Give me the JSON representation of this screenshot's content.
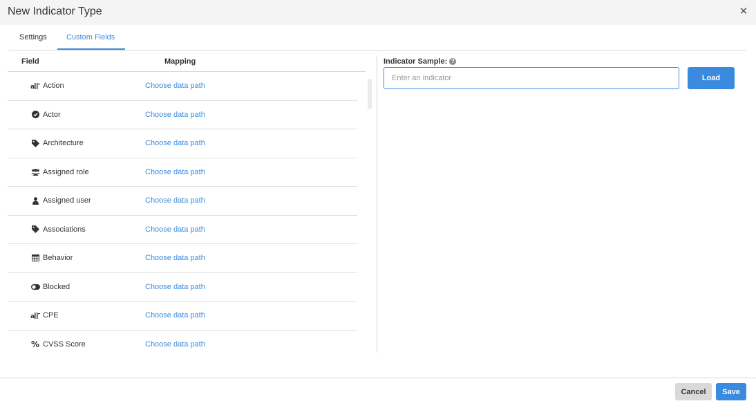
{
  "dialog": {
    "title": "New Indicator Type",
    "close_icon": "close-icon"
  },
  "tabs": [
    {
      "label": "Settings",
      "active": false
    },
    {
      "label": "Custom Fields",
      "active": true
    }
  ],
  "table": {
    "columns": [
      "Field",
      "Mapping"
    ],
    "rows": [
      {
        "icon": "short-text-icon",
        "label": "Action",
        "mapping": "Choose data path"
      },
      {
        "icon": "check-circle-icon",
        "label": "Actor",
        "mapping": "Choose data path"
      },
      {
        "icon": "tag-icon",
        "label": "Architecture",
        "mapping": "Choose data path"
      },
      {
        "icon": "users-icon",
        "label": "Assigned role",
        "mapping": "Choose data path"
      },
      {
        "icon": "user-icon",
        "label": "Assigned user",
        "mapping": "Choose data path"
      },
      {
        "icon": "tag-icon",
        "label": "Associations",
        "mapping": "Choose data path"
      },
      {
        "icon": "table-icon",
        "label": "Behavior",
        "mapping": "Choose data path"
      },
      {
        "icon": "toggle-icon",
        "label": "Blocked",
        "mapping": "Choose data path"
      },
      {
        "icon": "short-text-icon",
        "label": "CPE",
        "mapping": "Choose data path"
      },
      {
        "icon": "percent-icon",
        "label": "CVSS Score",
        "mapping": "Choose data path"
      }
    ]
  },
  "sample": {
    "label": "Indicator Sample:",
    "help_icon": "help-circle-icon",
    "input_value": "",
    "input_placeholder": "Enter an indicator",
    "load_label": "Load"
  },
  "footer": {
    "cancel_label": "Cancel",
    "save_label": "Save"
  },
  "colors": {
    "accent": "#3a8be0",
    "header_bg": "#f4f4f4",
    "cancel_bg": "#d9d9d9"
  }
}
